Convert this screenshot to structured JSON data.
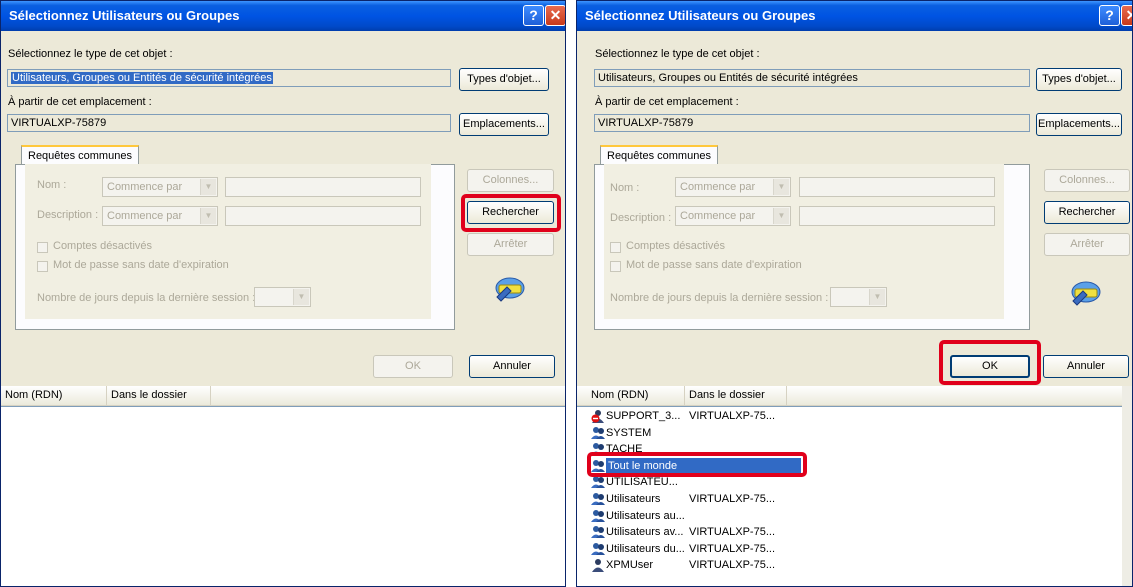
{
  "left_dialog": {
    "title": "Sélectionnez Utilisateurs ou Groupes",
    "help_glyph": "?",
    "close_glyph": "✕",
    "object_type_label": "Sélectionnez le type de cet objet :",
    "object_type_value": "Utilisateurs, Groupes ou Entités de sécurité intégrées",
    "object_types_button": "Types d'objet...",
    "location_label": "À partir de cet emplacement :",
    "location_value": "VIRTUALXP-75879",
    "locations_button": "Emplacements...",
    "tab_label": "Requêtes communes",
    "name_label": "Nom :",
    "name_combo": "Commence par",
    "desc_label": "Description :",
    "desc_combo": "Commence par",
    "disabled_accounts": "Comptes désactivés",
    "no_expire_pw": "Mot de passe sans date d'expiration",
    "days_label": "Nombre de jours depuis la dernière session :",
    "columns_button": "Colonnes...",
    "search_button": "Rechercher",
    "stop_button": "Arrêter",
    "ok_button": "OK",
    "cancel_button": "Annuler",
    "col_name": "Nom (RDN)",
    "col_folder": "Dans le dossier"
  },
  "right_dialog": {
    "title": "Sélectionnez Utilisateurs ou Groupes",
    "help_glyph": "?",
    "close_glyph": "✕",
    "object_type_label": "Sélectionnez le type de cet objet :",
    "object_type_value": "Utilisateurs, Groupes ou Entités de sécurité intégrées",
    "object_types_button": "Types d'objet...",
    "location_label": "À partir de cet emplacement :",
    "location_value": "VIRTUALXP-75879",
    "locations_button": "Emplacements...",
    "tab_label": "Requêtes communes",
    "name_label": "Nom :",
    "name_combo": "Commence par",
    "desc_label": "Description :",
    "desc_combo": "Commence par",
    "disabled_accounts": "Comptes désactivés",
    "no_expire_pw": "Mot de passe sans date d'expiration",
    "days_label": "Nombre de jours depuis la dernière session :",
    "columns_button": "Colonnes...",
    "search_button": "Rechercher",
    "stop_button": "Arrêter",
    "ok_button": "OK",
    "cancel_button": "Annuler",
    "col_name": "Nom (RDN)",
    "col_folder": "Dans le dossier",
    "results": [
      {
        "name": "SUPPORT_3...",
        "folder": "VIRTUALXP-75...",
        "icon": "user-disabled-icon"
      },
      {
        "name": "SYSTEM",
        "folder": "",
        "icon": "group-icon"
      },
      {
        "name": "TACHE",
        "folder": "",
        "icon": "group-icon"
      },
      {
        "name": "Tout le monde",
        "folder": "",
        "icon": "group-icon",
        "selected": true
      },
      {
        "name": "UTILISATEU...",
        "folder": "",
        "icon": "group-icon"
      },
      {
        "name": "Utilisateurs",
        "folder": "VIRTUALXP-75...",
        "icon": "group-icon"
      },
      {
        "name": "Utilisateurs au...",
        "folder": "",
        "icon": "group-icon"
      },
      {
        "name": "Utilisateurs av...",
        "folder": "VIRTUALXP-75...",
        "icon": "group-icon"
      },
      {
        "name": "Utilisateurs du...",
        "folder": "VIRTUALXP-75...",
        "icon": "group-icon"
      },
      {
        "name": "XPMUser",
        "folder": "VIRTUALXP-75...",
        "icon": "user-icon"
      }
    ]
  },
  "colors": {
    "highlight_red": "#e0001b",
    "selection_blue": "#316ac5",
    "dialog_bg": "#ece9d8",
    "titlebar_blue": "#0054e3"
  }
}
